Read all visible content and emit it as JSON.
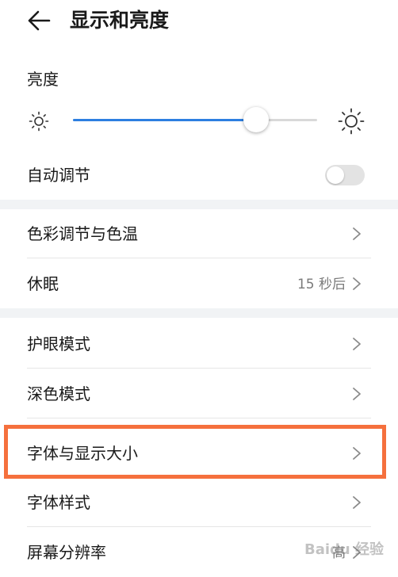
{
  "header": {
    "title": "显示和亮度"
  },
  "brightness": {
    "label": "亮度",
    "level_percent": 75
  },
  "auto_adjust": {
    "label": "自动调节",
    "enabled": false
  },
  "rows": [
    {
      "label": "色彩调节与色温",
      "value": ""
    },
    {
      "label": "休眠",
      "value": "15 秒后"
    },
    {
      "label": "护眼模式",
      "value": ""
    },
    {
      "label": "深色模式",
      "value": ""
    },
    {
      "label": "字体与显示大小",
      "value": ""
    },
    {
      "label": "字体样式",
      "value": ""
    },
    {
      "label": "屏幕分辨率",
      "value": "高"
    }
  ],
  "highlight_color": "#f5703d",
  "accent_color": "#2d7fe0",
  "watermark": "Baidu 经验"
}
